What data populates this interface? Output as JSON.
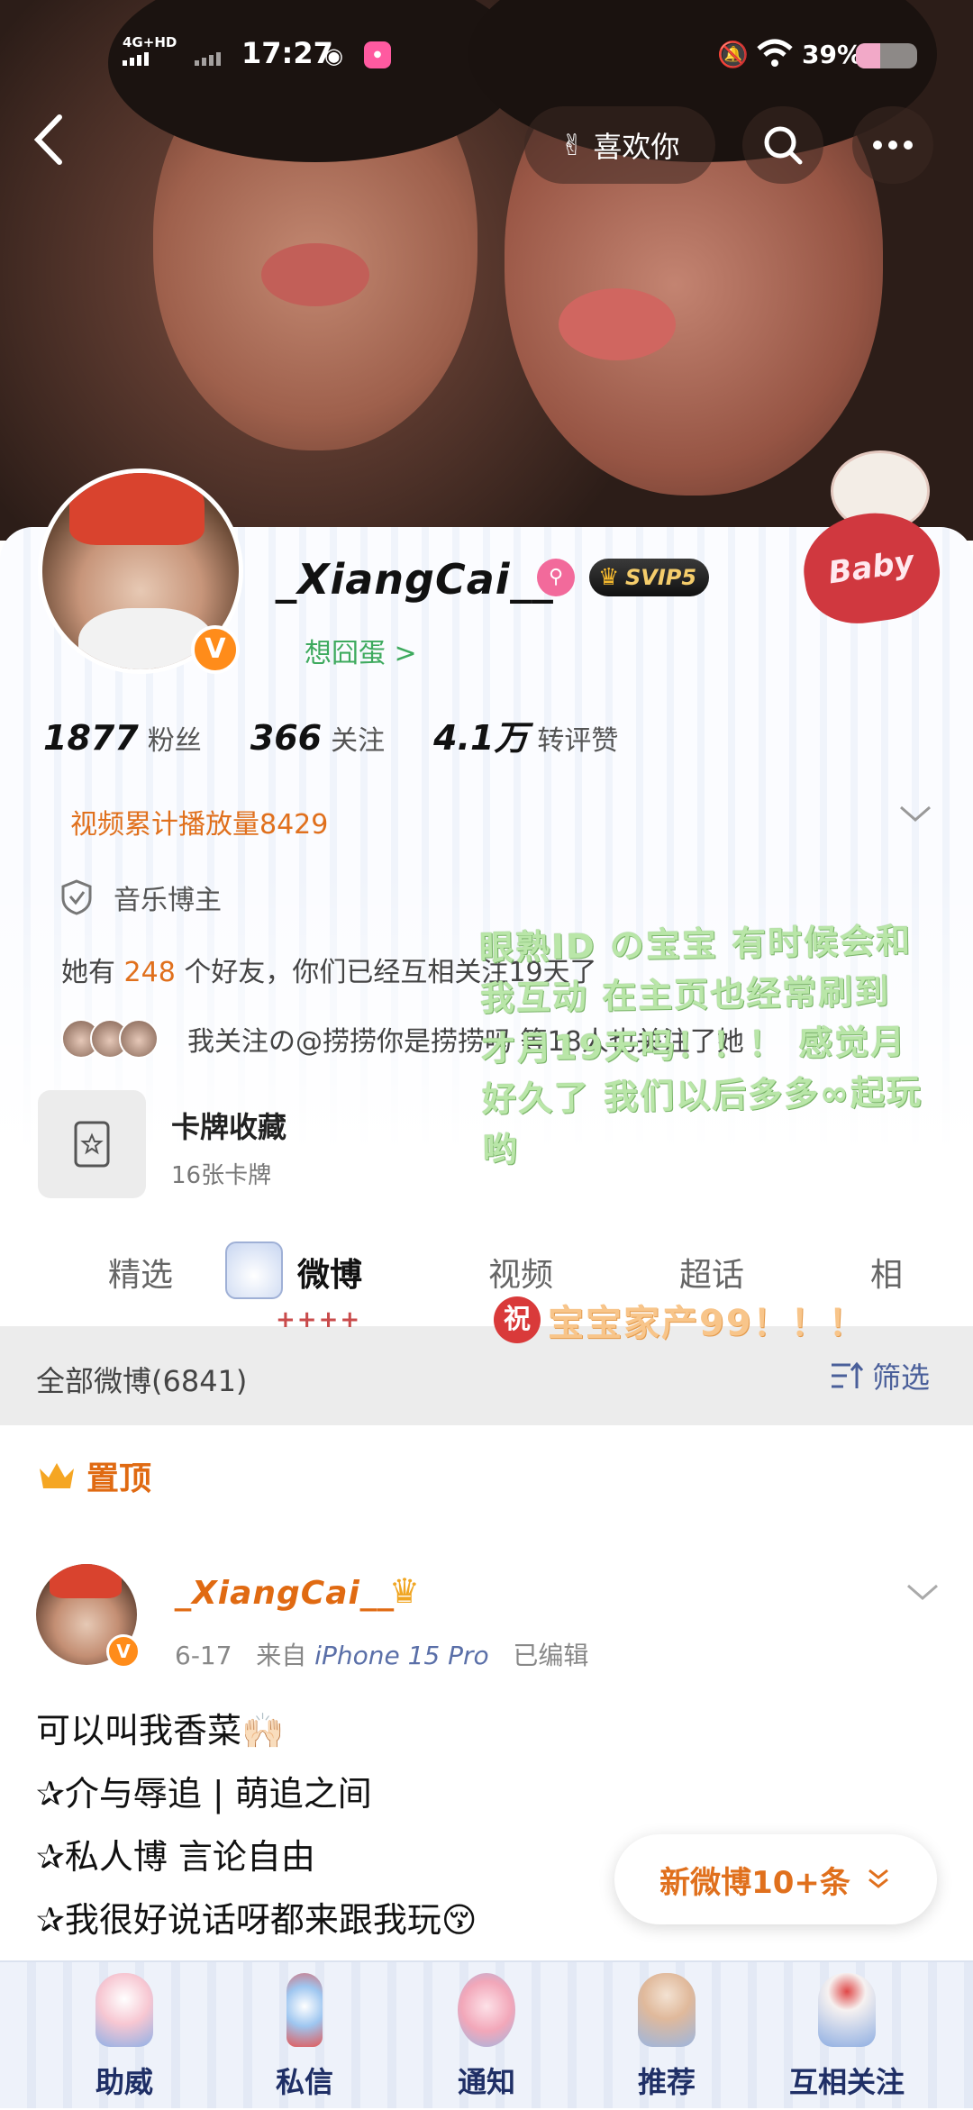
{
  "status_bar": {
    "network": "4G+HD",
    "time": "17:27",
    "battery_text": "39%",
    "battery_level": 0.39
  },
  "top_nav": {
    "like_label": "喜欢你"
  },
  "profile": {
    "username": "_XiangCai__",
    "vip_badge": "SVIP5",
    "green_link": "想囧蛋 >",
    "stats": [
      {
        "num": "1877",
        "label": "粉丝"
      },
      {
        "num": "366",
        "label": "关注"
      },
      {
        "num": "4.1万",
        "label": "转评赞"
      }
    ],
    "play_count": "视频累计播放量8429",
    "tag": "音乐博主",
    "friends_prefix": "她有",
    "friends_count": "248",
    "friends_suffix": "个好友，你们已经互相关注19天了",
    "mutual_text": "我关注の@捞捞你是捞捞吗 等18人也关注了她",
    "card_title": "卡牌收藏",
    "card_sub": "16张卡牌",
    "heart_text": "Baby"
  },
  "overlay": {
    "note": "眼熟ID の宝宝 有时候会和我互动 在主页也经常刷到 才月19天吗！！！ 感觉月好久了 我们以后多多∞起玩哟",
    "wish_char": "祝",
    "wish_text": "宝宝家产99！！！"
  },
  "tabs": {
    "items": [
      "精选",
      "微博",
      "视频",
      "超话",
      "相"
    ],
    "underline": "++++"
  },
  "filter": {
    "all_label": "全部微博(6841)",
    "filter_label": "筛选"
  },
  "pinned": {
    "label": "置顶"
  },
  "post": {
    "author": "_XiangCai__",
    "date": "6-17",
    "from": "来自",
    "device": "iPhone 15 Pro",
    "edited": "已编辑",
    "lines": [
      "可以叫我香菜🙌🏻",
      "✰介与辱追 | 萌追之间",
      "✰私人博 言论自由",
      "✰我很好说话呀都来跟我玩😚"
    ]
  },
  "new_posts": {
    "label": "新微博10+条"
  },
  "bottom_nav": {
    "items": [
      "助威",
      "私信",
      "通知",
      "推荐",
      "互相关注"
    ]
  }
}
